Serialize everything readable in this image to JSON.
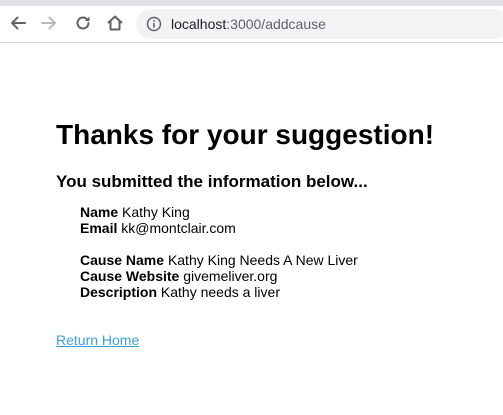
{
  "browser": {
    "url_host": "localhost",
    "url_path": ":3000/addcause",
    "icons": [
      "back-arrow-icon",
      "forward-arrow-icon",
      "reload-icon",
      "home-icon",
      "info-icon"
    ]
  },
  "page": {
    "title": "Thanks for your suggestion!",
    "subtitle": "You submitted the information below...",
    "fields": {
      "name_label": "Name",
      "name_value": "Kathy King",
      "email_label": "Email",
      "email_value": "kk@montclair.com",
      "cause_name_label": "Cause Name",
      "cause_name_value": "Kathy King Needs A New Liver",
      "cause_website_label": "Cause Website",
      "cause_website_value": "givemeliver.org",
      "description_label": "Description",
      "description_value": "Kathy needs a liver"
    },
    "return_link": "Return Home"
  },
  "colors": {
    "link": "#3b9fd8",
    "toolbar_icon": "#5f6368",
    "omnibox_bg": "#f1f3f4"
  }
}
